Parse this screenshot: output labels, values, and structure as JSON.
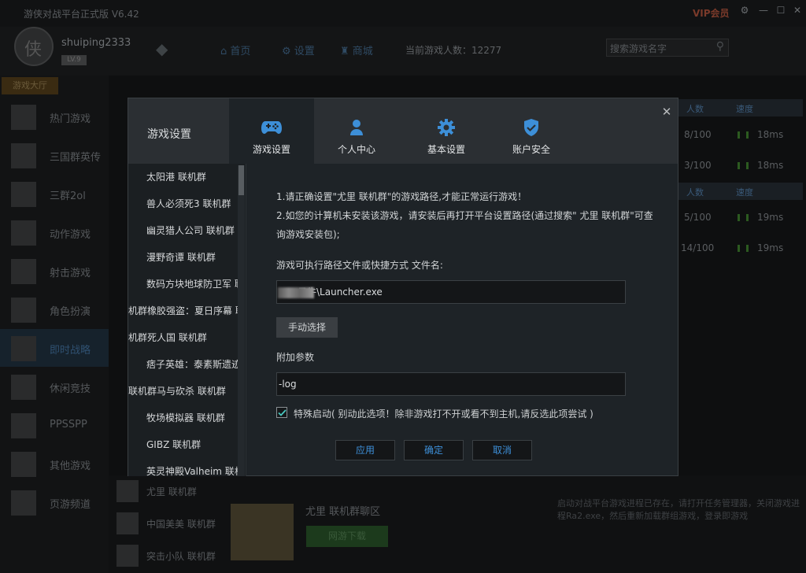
{
  "app": {
    "title": "游侠对战平台正式版 V6.42",
    "vip": "VIP会员",
    "window_controls": [
      "⚙",
      "—",
      "☐",
      "✕"
    ]
  },
  "user": {
    "name": "shuiping2333",
    "level": "LV.9"
  },
  "nav": {
    "items": [
      "首页",
      "设置",
      "商城"
    ]
  },
  "online_count": "当前游戏人数：12277",
  "search": {
    "placeholder": "搜索游戏名字"
  },
  "sidebar": {
    "header": "游戏大厅",
    "items": [
      {
        "label": "热门游戏"
      },
      {
        "label": "三国群英传"
      },
      {
        "label": "三群2ol"
      },
      {
        "label": "动作游戏"
      },
      {
        "label": "射击游戏"
      },
      {
        "label": "角色扮演"
      },
      {
        "label": "即时战略"
      },
      {
        "label": "休闲竞技"
      },
      {
        "label": "PPSSPP"
      },
      {
        "label": "其他游戏"
      },
      {
        "label": "页游频道"
      }
    ]
  },
  "bg_table": {
    "col_people": "人数",
    "col_speed": "速度",
    "rows": [
      {
        "people": "8/100",
        "speed": "18ms"
      },
      {
        "people": "3/100",
        "speed": "18ms"
      },
      {
        "people": "5/100",
        "speed": "19ms"
      },
      {
        "people": "14/100",
        "speed": "19ms"
      }
    ]
  },
  "bottom": {
    "list": [
      "尤里 联机群",
      "中国美美 联机群",
      "突击小队 联机群"
    ],
    "room_title": "尤里 联机群聊区",
    "download_button": "网游下载",
    "note": "启动对战平台游戏进程已存在，请打开任务管理器，关闭游戏进程Ra2.exe，然后重新加载群组游戏，登录即游戏"
  },
  "modal": {
    "title": "游戏设置",
    "tabs": [
      {
        "label": "游戏设置",
        "icon": "gamepad-icon"
      },
      {
        "label": "个人中心",
        "icon": "user-icon"
      },
      {
        "label": "基本设置",
        "icon": "gear-icon"
      },
      {
        "label": "账户安全",
        "icon": "shield-icon"
      }
    ],
    "games": [
      "太阳港 联机群",
      "兽人必须死3 联机群",
      "幽灵猎人公司 联机群",
      "漫野奇谭 联机群",
      "数码方块地球防卫军 联",
      "机群橡胶强盗：夏日序幕 联",
      "机群死人国 联机群",
      "痞子英雄：泰素斯遗迹",
      "联机群马与砍杀 联机群",
      "牧场模拟器 联机群",
      "GIBZ 联机群",
      "英灵神殿Valheim 联机"
    ],
    "notes": [
      "1.请正确设置\"尤里 联机群\"的游戏路径,才能正常运行游戏！",
      "2.如您的计算机未安装该游戏，请安装后再打开平台设置路径(通过搜索\" 尤里 联机群\"可查",
      "询游戏安装包);"
    ],
    "path_label": "游戏可执行路径文件或快捷方式 文件名:",
    "path_value": "日牛\\Launcher.exe",
    "choose_button": "手动选择",
    "args_label": "附加参数",
    "args_value": "-log",
    "special_start": {
      "checked": true,
      "label": "特殊启动( 别动此选项！除非游戏打不开或看不到主机,请反选此项尝试 )"
    },
    "buttons": {
      "apply": "应用",
      "ok": "确定",
      "cancel": "取消"
    },
    "accent": "#3d8fd8"
  }
}
